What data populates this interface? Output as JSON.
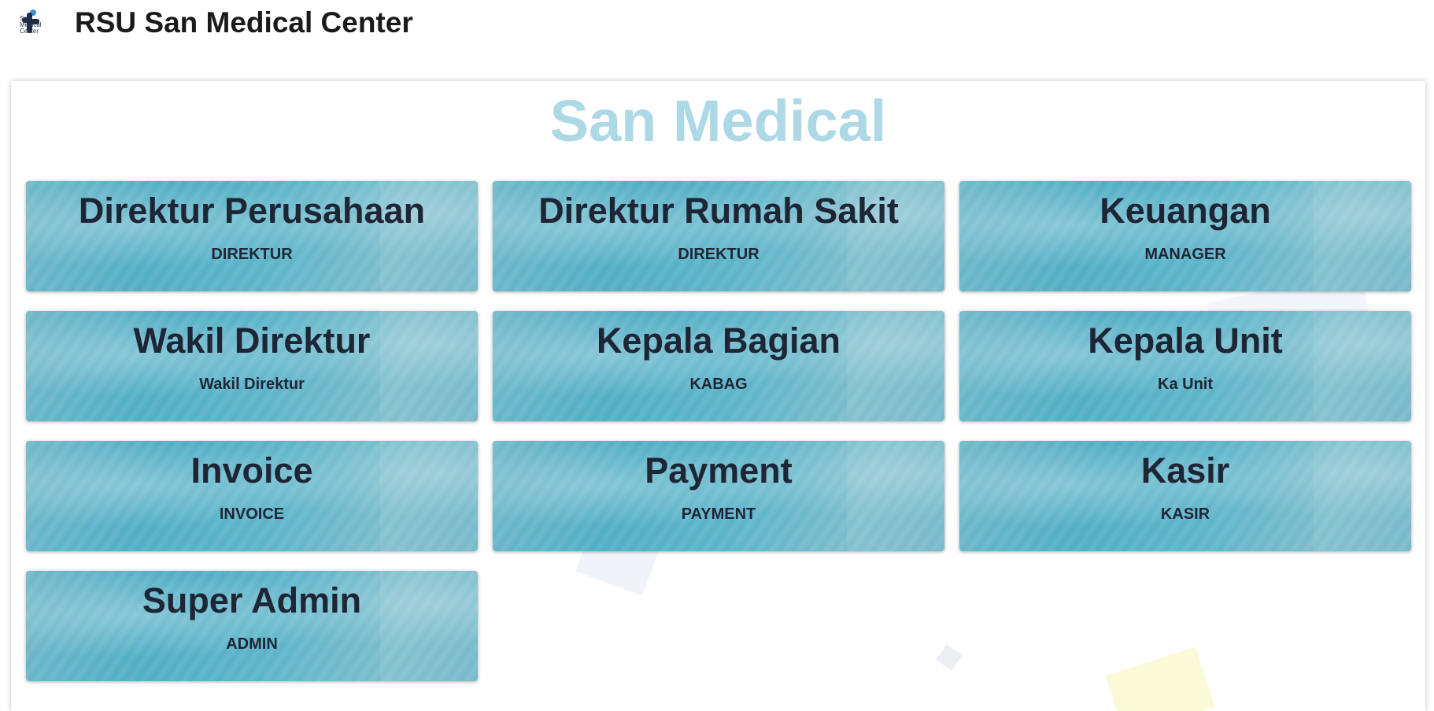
{
  "header": {
    "logo_text": "San Medical Center",
    "title": "RSU San Medical Center"
  },
  "panel": {
    "title": "San Medical"
  },
  "colors": {
    "panel_title": "#add8e6",
    "card_text": "#1e2535",
    "card_base": "#5ab3c8"
  },
  "roles": [
    {
      "title": "Direktur Perusahaan",
      "subtitle": "DIREKTUR"
    },
    {
      "title": "Direktur Rumah Sakit",
      "subtitle": "DIREKTUR"
    },
    {
      "title": "Keuangan",
      "subtitle": "MANAGER"
    },
    {
      "title": "Wakil Direktur",
      "subtitle": "Wakil Direktur"
    },
    {
      "title": "Kepala Bagian",
      "subtitle": "KABAG"
    },
    {
      "title": "Kepala Unit",
      "subtitle": "Ka Unit"
    },
    {
      "title": "Invoice",
      "subtitle": "INVOICE"
    },
    {
      "title": "Payment",
      "subtitle": "PAYMENT"
    },
    {
      "title": "Kasir",
      "subtitle": "KASIR"
    },
    {
      "title": "Super Admin",
      "subtitle": "ADMIN"
    }
  ]
}
